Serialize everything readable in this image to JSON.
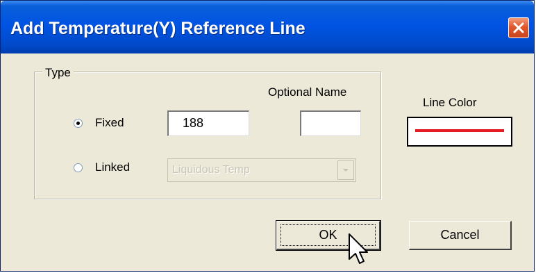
{
  "window": {
    "title": "Add Temperature(Y) Reference Line",
    "close_icon": "close-icon"
  },
  "type_group": {
    "legend": "Type",
    "optional_name_label": "Optional Name",
    "fixed": {
      "label": "Fixed",
      "selected": true,
      "value": "188"
    },
    "optional_name_value": "",
    "linked": {
      "label": "Linked",
      "selected": false,
      "dropdown_value": "Liquidous Temp",
      "enabled": false
    }
  },
  "line_color": {
    "label": "Line Color",
    "color": "#e51c23"
  },
  "buttons": {
    "ok": "OK",
    "cancel": "Cancel"
  },
  "colors": {
    "titlebar": "#0054e3",
    "dialog_bg": "#ece9d8"
  }
}
